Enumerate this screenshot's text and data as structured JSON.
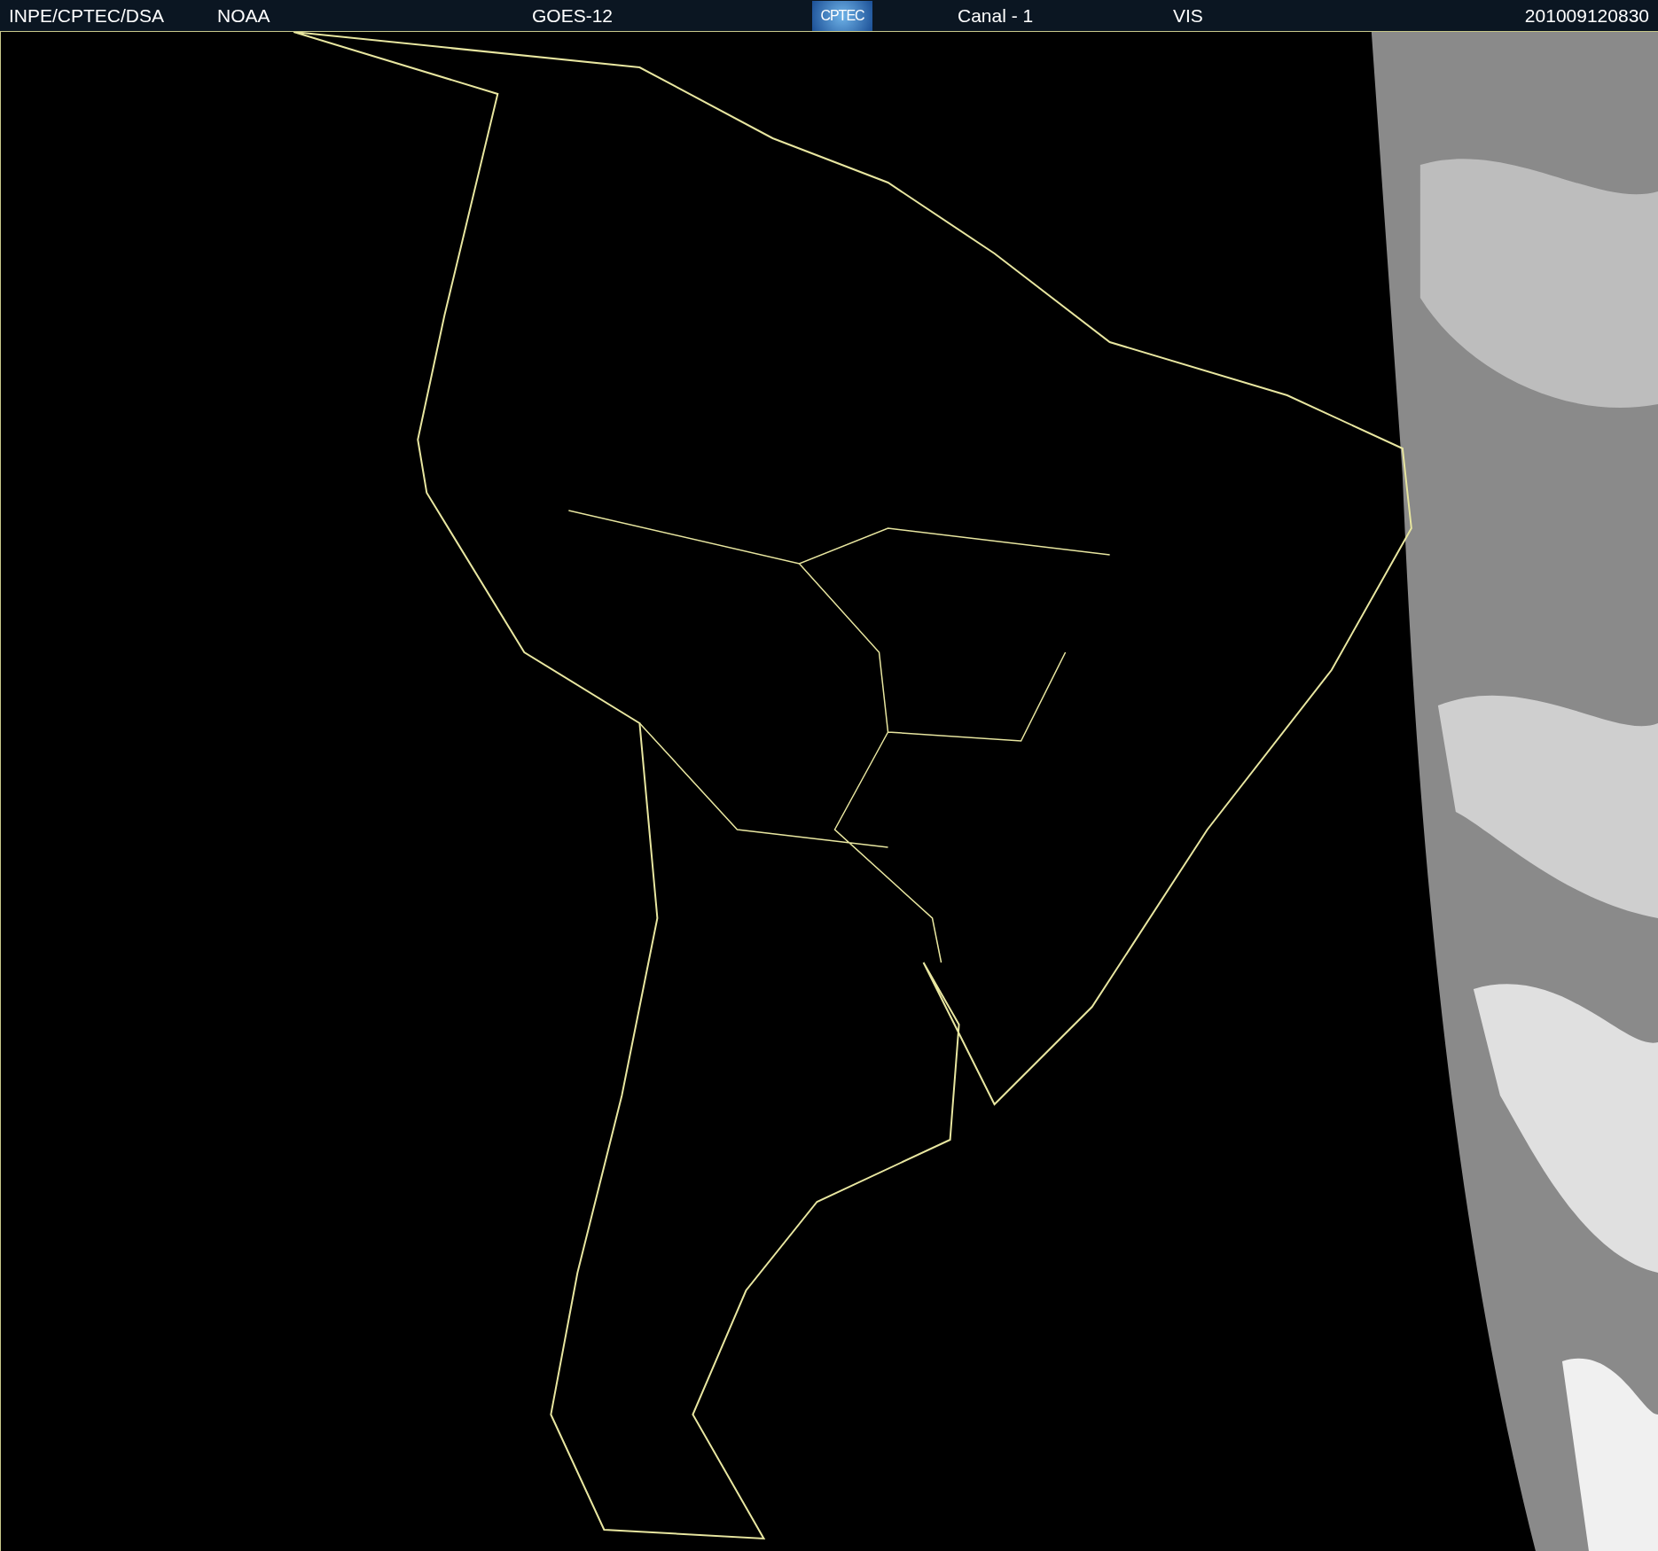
{
  "header": {
    "items": [
      {
        "kind": "text",
        "text": "INPE/CPTEC/DSA"
      },
      {
        "kind": "text",
        "text": "NOAA"
      },
      {
        "kind": "text",
        "text": "GOES-12"
      },
      {
        "kind": "logo",
        "text": "CPTEC"
      },
      {
        "kind": "text",
        "text": "Canal - 1"
      },
      {
        "kind": "text",
        "text": "VIS"
      },
      {
        "kind": "text",
        "text": "201009120830"
      }
    ]
  }
}
